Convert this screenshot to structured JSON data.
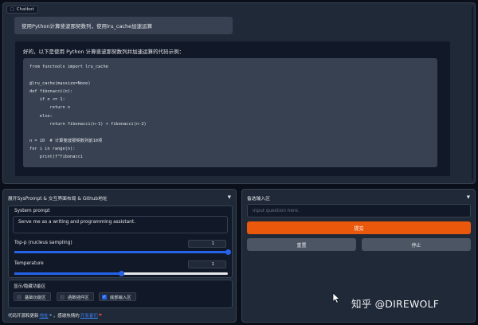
{
  "chatbot": {
    "tab_label": "Chatbot",
    "user_message": "使用Python计算斐波那契数列，使用lru_cache加速运算",
    "bot_intro": "好的，以下是使用 Python 计算斐波那契数列并加速运算的代码示例：",
    "code": "from functools import lru_cache\n\n@lru_cache(maxsize=None)\ndef fibonacci(n):\n    if n <= 1:\n        return n\n    else:\n        return fibonacci(n-1) + fibonacci(n-2)\n\nn = 10  # 计算斐波那契数列前10项\nfor i in range(n):\n    print(f\"fibonacci"
  },
  "settings": {
    "header": "展开SysPrompt & 交互界面布局 & Github地址",
    "system_prompt_label": "System prompt",
    "system_prompt_value": "Serve me as a writing and programming assistant.",
    "top_p": {
      "label": "Top-p (nucleus sampling)",
      "value": "1",
      "level": 1.0
    },
    "temperature": {
      "label": "Temperature",
      "value": "1",
      "level": 0.5
    },
    "visibility_title": "显示/隐藏功能区",
    "checkboxes": [
      {
        "label": "基础功能区",
        "checked": false
      },
      {
        "label": "函数插件区",
        "checked": false
      },
      {
        "label": "底部输入区",
        "checked": true
      }
    ],
    "footer": {
      "prefix": "代码开源和更新",
      "link1": "地址",
      "middle": "，感谢热情的",
      "link2": "开发者们"
    }
  },
  "input_panel": {
    "header": "备选输入区",
    "placeholder": "Input question here.",
    "submit_label": "提交",
    "reset_label": "重置",
    "stop_label": "停止"
  },
  "watermark": "知乎 @DIREWOLF",
  "colors": {
    "accent": "#2563eb",
    "submit": "#ea580c",
    "panel": "#1f2937",
    "background": "#0b0f19"
  }
}
